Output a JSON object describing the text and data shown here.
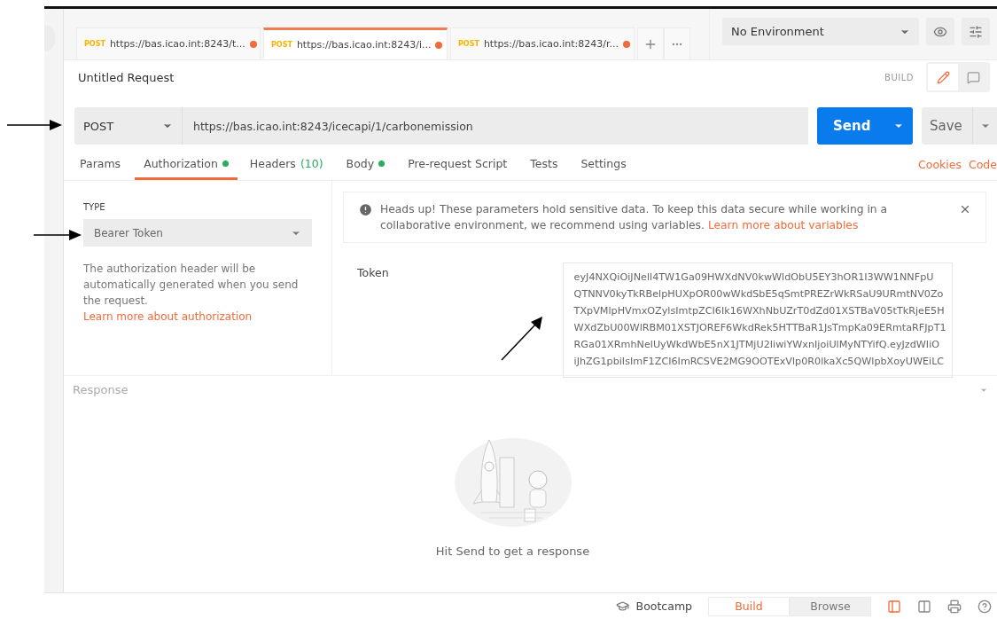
{
  "request_tabs": [
    {
      "method": "POST",
      "url": "https://bas.icao.int:8243/t...",
      "selected": false,
      "unsaved": true
    },
    {
      "method": "POST",
      "url": "https://bas.icao.int:8243/i...",
      "selected": true,
      "unsaved": true
    },
    {
      "method": "POST",
      "url": "https://bas.icao.int:8243/r...",
      "selected": false,
      "unsaved": true
    }
  ],
  "environment": {
    "value": "No Environment"
  },
  "title": "Untitled Request",
  "mode_label": "BUILD",
  "request": {
    "method": "POST",
    "url": "https://bas.icao.int:8243/icecapi/1/carbonemission",
    "send": "Send",
    "save": "Save"
  },
  "section_tabs": [
    {
      "label": "Params",
      "selected": false
    },
    {
      "label": "Authorization",
      "selected": true,
      "dot": true
    },
    {
      "label": "Headers",
      "count": "(10)",
      "selected": false
    },
    {
      "label": "Body",
      "selected": false,
      "dot": true
    },
    {
      "label": "Pre-request Script",
      "selected": false
    },
    {
      "label": "Tests",
      "selected": false
    },
    {
      "label": "Settings",
      "selected": false
    }
  ],
  "links": [
    "Cookies",
    "Code"
  ],
  "auth": {
    "type_label": "TYPE",
    "type": "Bearer Token",
    "description": "The authorization header will be automatically generated when you send the request.",
    "description_link": "Learn more about authorization",
    "notice": "Heads up! These parameters hold sensitive data. To keep this data secure while working in a collaborative environment, we recommend using variables.",
    "notice_link": "Learn more about variables",
    "token_label": "Token",
    "token_lines": [
      "eyJ4NXQiOiJNell4TW1Ga09HWXdNV0kwWldObU5EY3hOR1I3WW1NNFpU",
      "QTNNV0kyTkRBelpHUXpOR00wWkdSbE5qSmtPREZrWkRSaU9URmtNV0Zo",
      "TXpVMlpHVmxOZylsImtpZCI6Ik16WXhNbUZrT0dZd01XSTBaV05tTkRjeE5H",
      "WXdZbU00WlRBM01XSTJOREF6WkdRek5HTTBaR1JsTmpKa09ERmtaRFJpT1",
      "RGa01XRmhNelUyWkdWbE5nX1JTMjU2IiwiYWxnIjoiUlMyNTYifQ.eyJzdWIiO",
      "iJhZG1pbiIsImF1ZCI6ImRCSVE2MG9OOTExVlp0R0lkaXc5QWlpbXoyUWEiLC"
    ]
  },
  "response": {
    "title": "Response",
    "empty_message": "Hit Send to get a response"
  },
  "status_bar": {
    "bootcamp": "Bootcamp",
    "modes": [
      {
        "label": "Build",
        "selected": true
      },
      {
        "label": "Browse",
        "selected": false
      }
    ]
  }
}
